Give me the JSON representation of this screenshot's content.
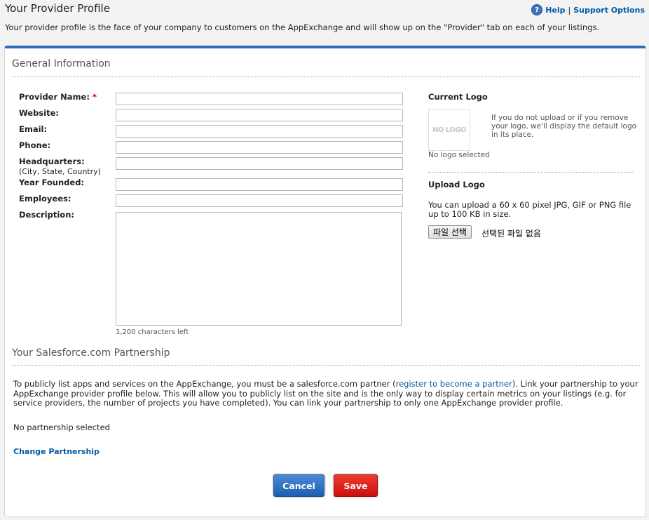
{
  "header": {
    "title": "Your Provider Profile",
    "help_label": "Help",
    "support_label": "Support Options",
    "separator": "|",
    "intro": "Your provider profile is the face of your company to customers on the AppExchange and will show up on the \"Provider\" tab on each of your listings."
  },
  "general": {
    "section_title": "General Information",
    "fields": {
      "provider_name": {
        "label": "Provider Name:",
        "required_mark": "*",
        "value": ""
      },
      "website": {
        "label": "Website:",
        "value": ""
      },
      "email": {
        "label": "Email:",
        "value": ""
      },
      "phone": {
        "label": "Phone:",
        "value": ""
      },
      "headquarters": {
        "label": "Headquarters:",
        "sublabel": "(City, State, Country)",
        "value": ""
      },
      "year_founded": {
        "label": "Year Founded:",
        "value": ""
      },
      "employees": {
        "label": "Employees:",
        "value": ""
      },
      "description": {
        "label": "Description:",
        "value": "",
        "chars_left": "1,200 characters left"
      }
    }
  },
  "logo": {
    "current_title": "Current Logo",
    "placeholder_text": "NO LOGO",
    "note": "If you do not upload or if you remove your logo, we'll display the default logo in its place.",
    "status": "No logo selected",
    "upload_title": "Upload Logo",
    "upload_note": "You can upload a 60 x 60 pixel JPG, GIF or PNG file up to 100 KB in size.",
    "file_button": "파일 선택",
    "file_status": "선택된 파일 없음"
  },
  "partnership": {
    "section_title": "Your Salesforce.com Partnership",
    "text_before_link": "To publicly list apps and services on the AppExchange, you must be a salesforce.com partner (",
    "link_text": "register to become a partner",
    "text_after_link": "). Link your partnership to your AppExchange provider profile below. This will allow you to publicly list on the site and is the only way to display certain metrics on your listings (e.g. for service providers, the number of projects you have completed). You can link your partnership to only one AppExchange provider profile.",
    "status": "No partnership selected",
    "change_link": "Change Partnership"
  },
  "actions": {
    "cancel_label": "Cancel",
    "save_label": "Save"
  },
  "colors": {
    "accent_blue": "#2d6dbb",
    "link_blue": "#015ba7",
    "save_red": "#d91b17"
  }
}
